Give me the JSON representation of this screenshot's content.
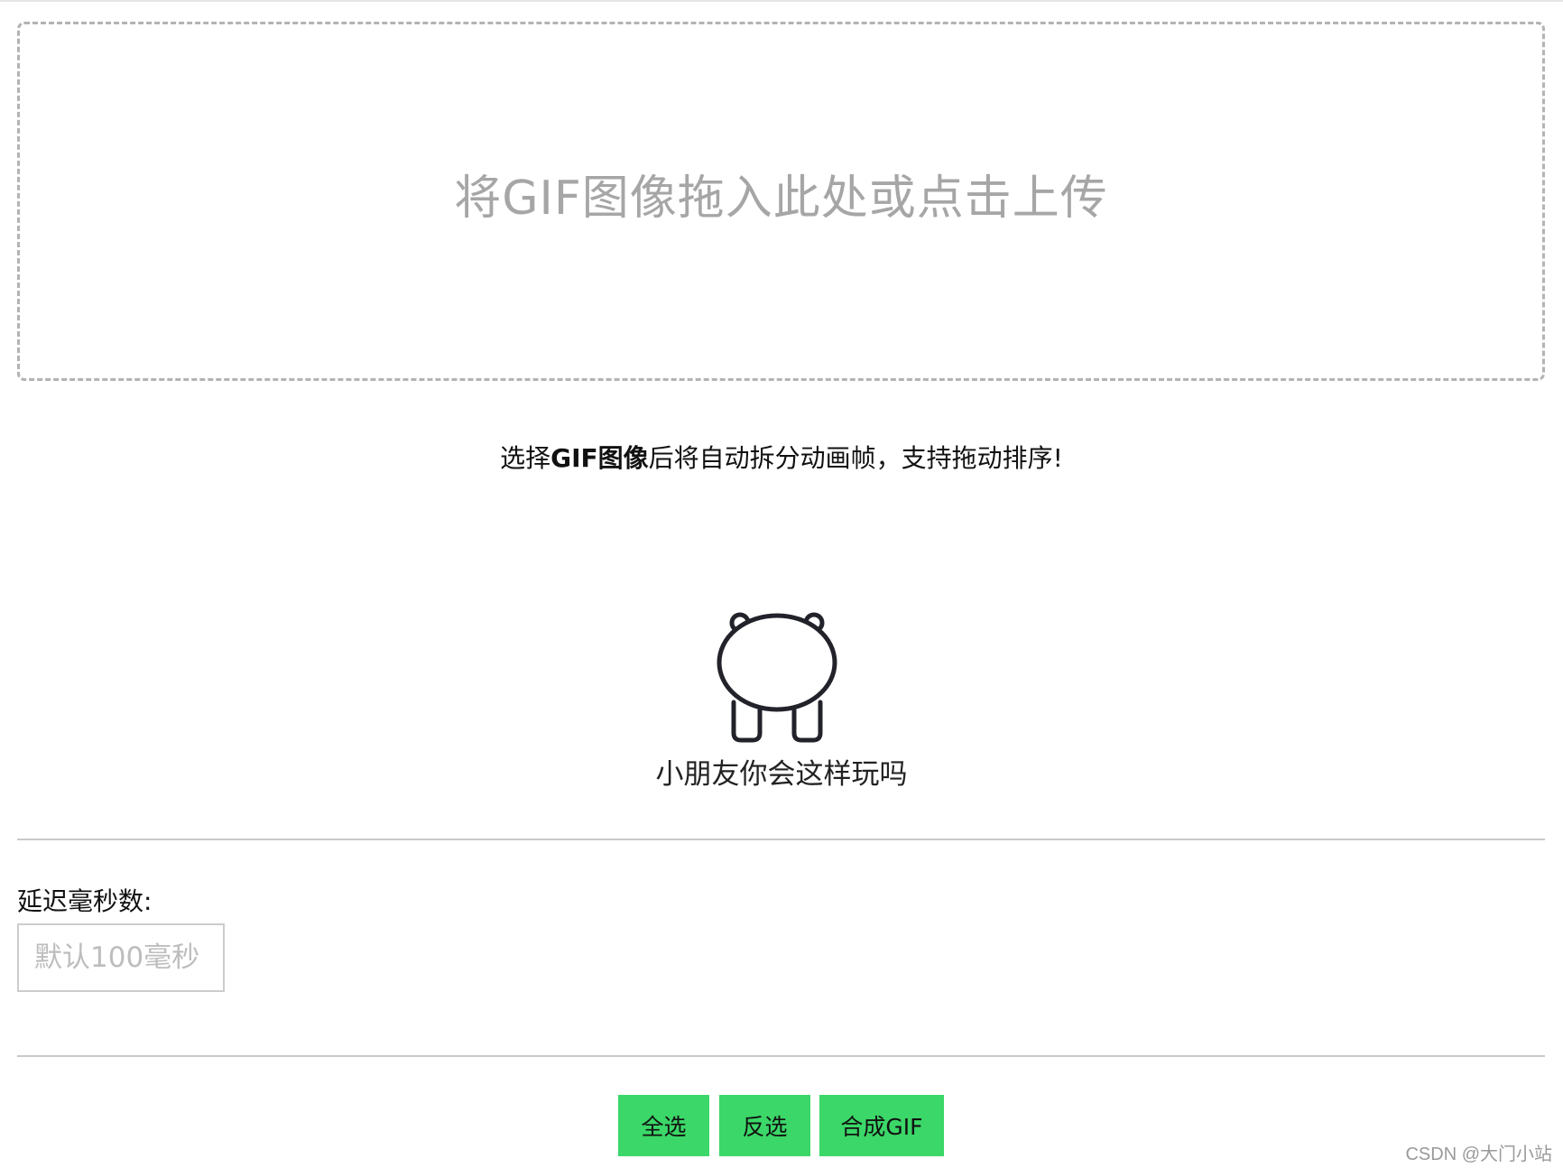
{
  "upload": {
    "dropzone_text": "将GIF图像拖入此处或点击上传"
  },
  "hint": {
    "prefix": "选择",
    "bold": "GIF图像",
    "suffix": "后将自动拆分动画帧，支持拖动排序!"
  },
  "empty_state": {
    "icon": "bear-icon",
    "text": "小朋友你会这样玩吗"
  },
  "delay": {
    "label": "延迟毫秒数:",
    "value": "",
    "placeholder": "默认100毫秒"
  },
  "actions": {
    "select_all": "全选",
    "invert_selection": "反选",
    "compose_gif": "合成GIF"
  },
  "watermark": "CSDN @大门小站",
  "colors": {
    "button_bg": "#3bd768",
    "dropzone_border": "#b3b3b3",
    "dropzone_text": "#a6a6a6"
  }
}
